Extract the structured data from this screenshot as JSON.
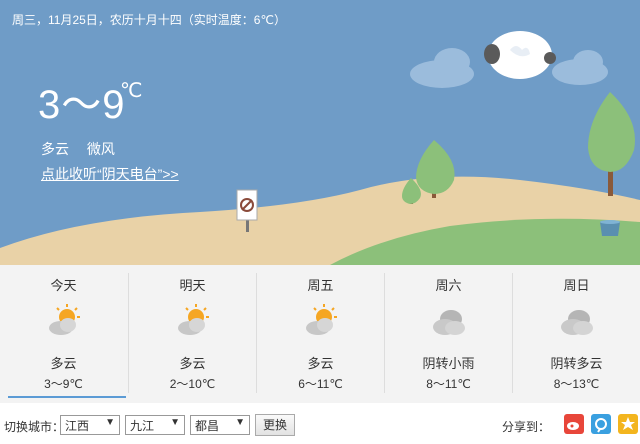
{
  "header": {
    "date_line": "周三，11月25日，农历十月十四（实时温度：6℃）",
    "temperature": "3～9",
    "temp_unit": "℃",
    "condition": "多云",
    "wind": "微风",
    "radio_link": "点此收听“阴天电台”>>"
  },
  "forecast": [
    {
      "day": "今天",
      "condition": "多云",
      "range": "3～9℃",
      "icon": "partly-cloudy-icon"
    },
    {
      "day": "明天",
      "condition": "多云",
      "range": "2～10℃",
      "icon": "partly-cloudy-icon"
    },
    {
      "day": "周五",
      "condition": "多云",
      "range": "6～11℃",
      "icon": "partly-cloudy-icon"
    },
    {
      "day": "周六",
      "condition": "阴转小雨",
      "range": "8～11℃",
      "icon": "overcast-icon"
    },
    {
      "day": "周日",
      "condition": "阴转多云",
      "range": "8～13℃",
      "icon": "overcast-icon"
    }
  ],
  "footer": {
    "switch_label": "切换城市：",
    "province": "江西",
    "city": "九江",
    "county": "都昌",
    "switch_button": "更换",
    "share_label": "分享到："
  },
  "colors": {
    "sky": "#6f9cc7",
    "sand": "#e9d2a7",
    "grass": "#8cc07a",
    "active_tab": "#5b9bd5"
  }
}
